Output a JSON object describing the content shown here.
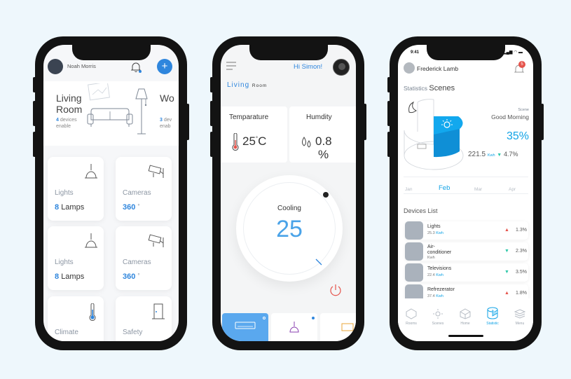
{
  "phone1": {
    "user_name": "Noah Morris",
    "rooms": [
      {
        "name_line1": "Living",
        "name_line2": "Room",
        "count": "4",
        "caption_a": "devices",
        "caption_b": "enable"
      },
      {
        "name_line1": "Wo",
        "name_line2": "",
        "count": "3",
        "caption_a": "dev",
        "caption_b": "enab"
      }
    ],
    "tiles": [
      {
        "label": "Lights",
        "value": "8",
        "unit": "Lamps",
        "icon": "ceiling-lamp-icon"
      },
      {
        "label": "Cameras",
        "value": "360",
        "unit": "°",
        "icon": "security-camera-icon"
      },
      {
        "label": "Lights",
        "value": "8",
        "unit": "Lamps",
        "icon": "ceiling-lamp-icon"
      },
      {
        "label": "Cameras",
        "value": "360",
        "unit": "°",
        "icon": "security-camera-icon"
      },
      {
        "label": "Climate",
        "icon": "thermometer-icon"
      },
      {
        "label": "Safety",
        "icon": "door-icon"
      }
    ]
  },
  "phone2": {
    "greeting": "Hi Simon!",
    "title_main": "Living",
    "title_sub": "Room",
    "temperature": {
      "label": "Temparature",
      "value": "25",
      "unit": "C",
      "deg": "°"
    },
    "humidity": {
      "label": "Humdity",
      "value": "0.8",
      "unit": "%"
    },
    "dial": {
      "mode": "Cooling",
      "value": "25",
      "level": 0.75
    }
  },
  "phone3": {
    "time": "9:41",
    "user_name": "Frederick Lamb",
    "notifications": "5",
    "section_label": "Statistics",
    "section_title": "Scenes",
    "scene_label": "Scene",
    "scene_name": "Good Morning",
    "percent": "35%",
    "kwh_value": "221.5",
    "kwh_unit": "Kwh",
    "change": "4.7%",
    "months": [
      "Jan",
      "Feb",
      "Mar",
      "Apr"
    ],
    "active_month": "Feb",
    "devices_title": "Devices List",
    "devices": [
      {
        "name": "Lights",
        "value": "25.3",
        "unit": "Kwh",
        "change": "1.3%",
        "trend": "up"
      },
      {
        "name": "Air-",
        "name2": "conditioner",
        "overlay": "6bbBe",
        "value": "",
        "unit": "Kwh",
        "change": "2.3%",
        "trend": "down"
      },
      {
        "name": "Televisions",
        "value": "22.4",
        "unit": "Kwh",
        "change": "3.5%",
        "trend": "down"
      },
      {
        "name": "Refrezerator",
        "value": "37.4",
        "unit": "Kwh",
        "change": "1.8%",
        "trend": "up"
      }
    ],
    "tabs": [
      "Rooms",
      "Scenes",
      "Home",
      "Statistic",
      "Menu"
    ],
    "active_tab": "Statistic",
    "colors": {
      "accent": "#11a3e6",
      "up": "#e5534b",
      "down": "#2bc7a8"
    }
  }
}
